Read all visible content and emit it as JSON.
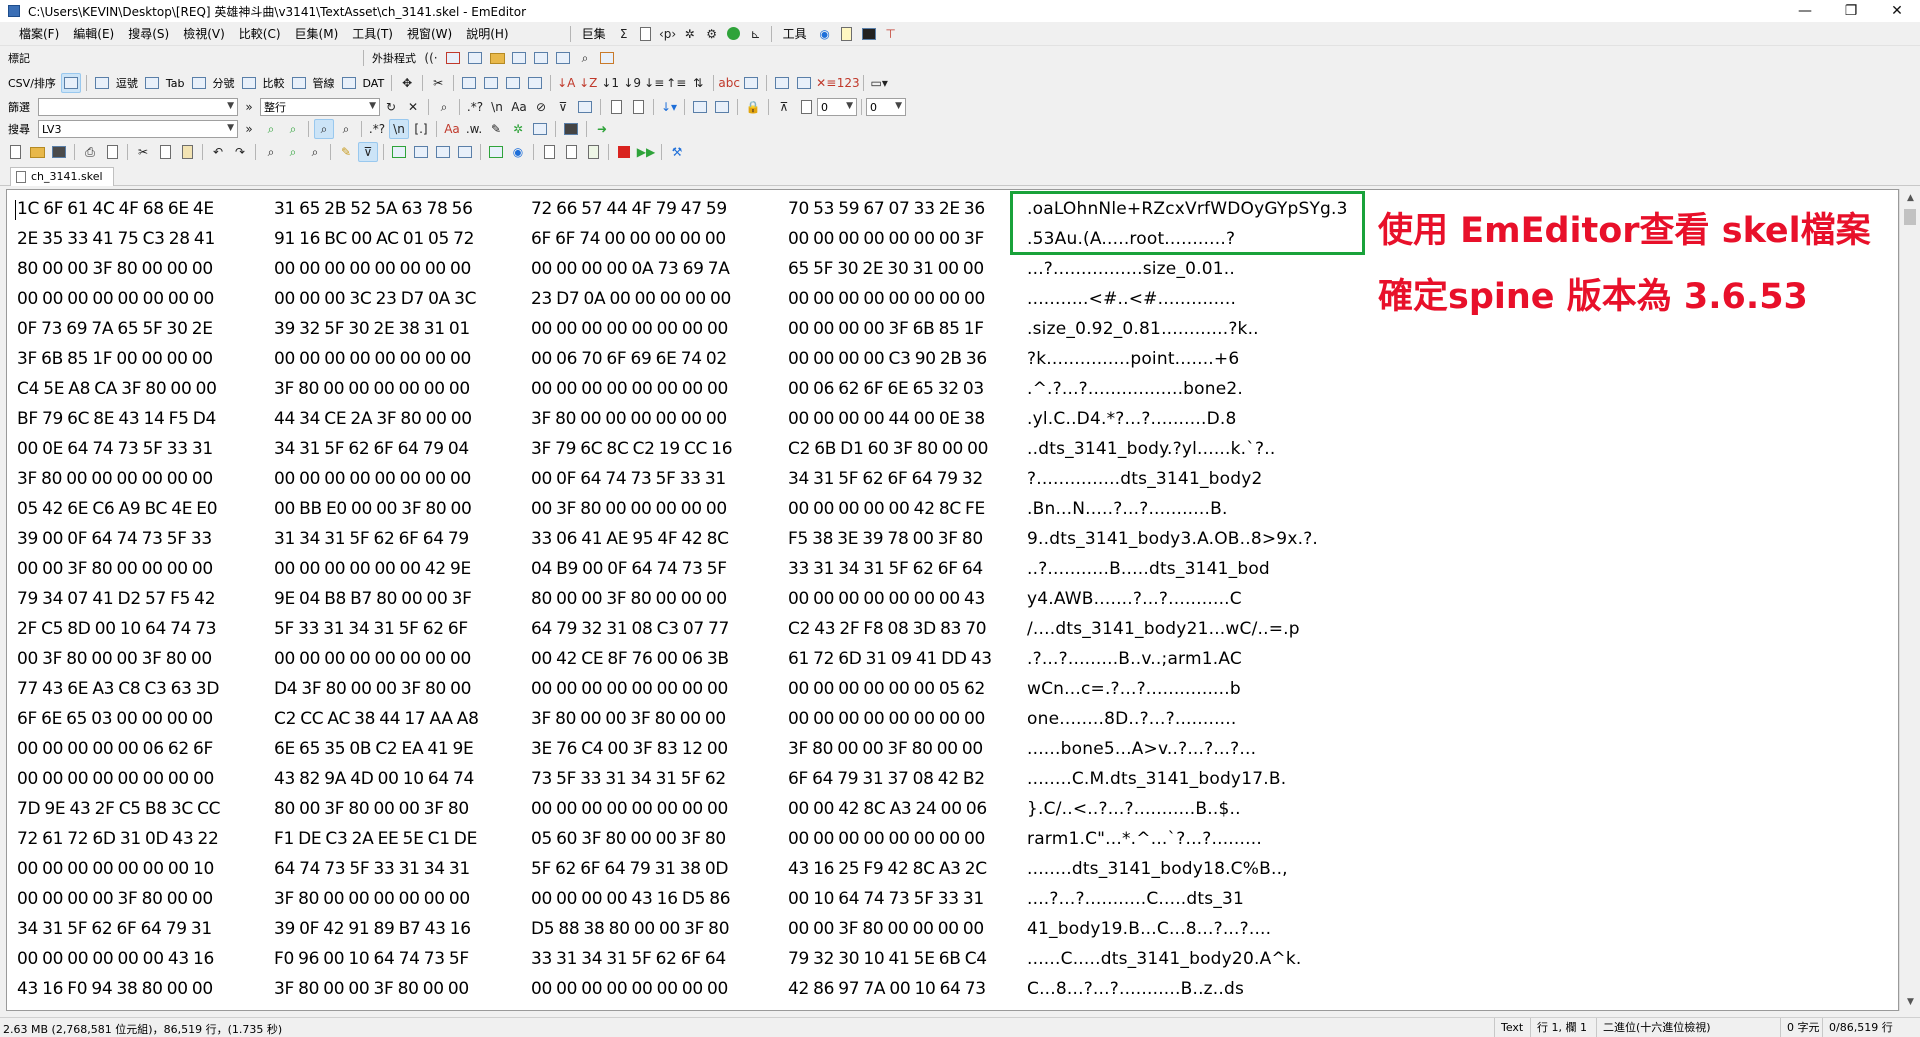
{
  "window": {
    "title": "C:\\Users\\KEVIN\\Desktop\\[REQ] 英雄神斗曲\\v3141\\TextAsset\\ch_3141.skel - EmEditor",
    "minimize": "—",
    "maximize": "❐",
    "close": "✕"
  },
  "menu": {
    "items": [
      "檔案(F)",
      "編輯(E)",
      "搜尋(S)",
      "檢視(V)",
      "比較(C)",
      "巨集(M)",
      "工具(T)",
      "視窗(W)",
      "說明(H)"
    ],
    "macro_label": "巨集",
    "tools_label": "工具"
  },
  "toolbars": {
    "bookmark_label": "標記",
    "external_label": "外掛程式",
    "csv_label": "CSV/排序",
    "csv_modes": [
      "逗號",
      "Tab",
      "分號",
      "比較",
      "管線",
      "DAT"
    ],
    "filter_label": "篩選",
    "filter_value": "",
    "filter_mode": "整行",
    "search_label": "搜尋",
    "search_value": "LV3",
    "dropdown_value_a": "0",
    "dropdown_value_b": "0"
  },
  "tab": {
    "filename": "ch_3141.skel"
  },
  "hex": {
    "rows": [
      [
        "1C 6F 61 4C 4F 68 6E 4E",
        "31 65 2B 52 5A 63 78 56",
        "72 66 57 44 4F 79 47 59",
        "70 53 59 67 07 33 2E 36"
      ],
      [
        "2E 35 33 41 75 C3 28 41",
        "91 16 BC 00 AC 01 05 72",
        "6F 6F 74 00 00 00 00 00",
        "00 00 00 00 00 00 00 3F"
      ],
      [
        "80 00 00 3F 80 00 00 00",
        "00 00 00 00 00 00 00 00",
        "00 00 00 00 0A 73 69 7A",
        "65 5F 30 2E 30 31 00 00"
      ],
      [
        "00 00 00 00 00 00 00 00",
        "00 00 00 3C 23 D7 0A 3C",
        "23 D7 0A 00 00 00 00 00",
        "00 00 00 00 00 00 00 00"
      ],
      [
        "0F 73 69 7A 65 5F 30 2E",
        "39 32 5F 30 2E 38 31 01",
        "00 00 00 00 00 00 00 00",
        "00 00 00 00 3F 6B 85 1F"
      ],
      [
        "3F 6B 85 1F 00 00 00 00",
        "00 00 00 00 00 00 00 00",
        "00 06 70 6F 69 6E 74 02",
        "00 00 00 00 C3 90 2B 36"
      ],
      [
        "C4 5E A8 CA 3F 80 00 00",
        "3F 80 00 00 00 00 00 00",
        "00 00 00 00 00 00 00 00",
        "00 06 62 6F 6E 65 32 03"
      ],
      [
        "BF 79 6C 8E 43 14 F5 D4",
        "44 34 CE 2A 3F 80 00 00",
        "3F 80 00 00 00 00 00 00",
        "00 00 00 00 44 00 0E 38"
      ],
      [
        "00 0E 64 74 73 5F 33 31",
        "34 31 5F 62 6F 64 79 04",
        "3F 79 6C 8C C2 19 CC 16",
        "C2 6B D1 60 3F 80 00 00"
      ],
      [
        "3F 80 00 00 00 00 00 00",
        "00 00 00 00 00 00 00 00",
        "00 0F 64 74 73 5F 33 31",
        "34 31 5F 62 6F 64 79 32"
      ],
      [
        "05 42 6E C6 A9 BC 4E E0",
        "00 BB E0 00 00 3F 80 00",
        "00 3F 80 00 00 00 00 00",
        "00 00 00 00 00 42 8C FE"
      ],
      [
        "39 00 0F 64 74 73 5F 33",
        "31 34 31 5F 62 6F 64 79",
        "33 06 41 AE 95 4F 42 8C",
        "F5 38 3E 39 78 00 3F 80"
      ],
      [
        "00 00 3F 80 00 00 00 00",
        "00 00 00 00 00 00 42 9E",
        "04 B9 00 0F 64 74 73 5F",
        "33 31 34 31 5F 62 6F 64"
      ],
      [
        "79 34 07 41 D2 57 F5 42",
        "9E 04 B8 B7 80 00 00 3F",
        "80 00 00 3F 80 00 00 00",
        "00 00 00 00 00 00 00 43"
      ],
      [
        "2F C5 8D 00 10 64 74 73",
        "5F 33 31 34 31 5F 62 6F",
        "64 79 32 31 08 C3 07 77",
        "C2 43 2F F8 08 3D 83 70"
      ],
      [
        "00 3F 80 00 00 3F 80 00",
        "00 00 00 00 00 00 00 00",
        "00 42 CE 8F 76 00 06 3B",
        "61 72 6D 31 09 41 DD 43"
      ],
      [
        "77 43 6E A3 C8 C3 63 3D",
        "D4 3F 80 00 00 3F 80 00",
        "00 00 00 00 00 00 00 00",
        "00 00 00 00 00 00 05 62"
      ],
      [
        "6F 6E 65 03 00 00 00 00",
        "C2 CC AC 38 44 17 AA A8",
        "3F 80 00 00 3F 80 00 00",
        "00 00 00 00 00 00 00 00"
      ],
      [
        "00 00 00 00 00 06 62 6F",
        "6E 65 35 0B C2 EA 41 9E",
        "3E 76 C4 00 3F 83 12 00",
        "3F 80 00 00 3F 80 00 00"
      ],
      [
        "00 00 00 00 00 00 00 00",
        "43 82 9A 4D 00 10 64 74",
        "73 5F 33 31 34 31 5F 62",
        "6F 64 79 31 37 08 42 B2"
      ],
      [
        "7D 9E 43 2F C5 B8 3C CC",
        "80 00 3F 80 00 00 3F 80",
        "00 00 00 00 00 00 00 00",
        "00 00 42 8C A3 24 00 06"
      ],
      [
        "72 61 72 6D 31 0D 43 22",
        "F1 DE C3 2A EE 5E C1 DE",
        "05 60 3F 80 00 00 3F 80",
        "00 00 00 00 00 00 00 00"
      ],
      [
        "00 00 00 00 00 00 00 10",
        "64 74 73 5F 33 31 34 31",
        "5F 62 6F 64 79 31 38 0D",
        "43 16 25 F9 42 8C A3 2C"
      ],
      [
        "00 00 00 00 3F 80 00 00",
        "3F 80 00 00 00 00 00 00",
        "00 00 00 00 43 16 D5 86",
        "00 10 64 74 73 5F 33 31"
      ],
      [
        "34 31 5F 62 6F 64 79 31",
        "39 0F 42 91 89 B7 43 16",
        "D5 88 38 80 00 00 3F 80",
        "00 00 3F 80 00 00 00 00"
      ],
      [
        "00 00 00 00 00 00 43 16",
        "F0 96 00 10 64 74 73 5F",
        "33 31 34 31 5F 62 6F 64",
        "79 32 30 10 41 5E 6B C4"
      ],
      [
        "43 16 F0 94 38 80 00 00",
        "3F 80 00 00 3F 80 00 00",
        "00 00 00 00 00 00 00 00",
        "42 86 97 7A 00 10 64 73"
      ]
    ],
    "ascii": [
      ".oaLOhnNle+RZcxVrfWDOyGYpSYg.3.6",
      ".53Au.(A.....root...........?",
      "...?................size_0.01..",
      "...........<#..<#..............",
      ".size_0.92_0.81............?k..",
      "?k...............point.......+6",
      ".^.?...?.................bone2.",
      ".yl.C..D4.*?...?..........D.8",
      "..dts_3141_body.?yl......k.`?..",
      "?...............dts_3141_body2",
      ".Bn...N.....?...?...........B.",
      "9..dts_3141_body3.A.OB..8>9x.?.",
      "..?...........B.....dts_3141_bod",
      "y4.AWB.......?...?...........C",
      "/....dts_3141_body21...wC/..=.p",
      ".?...?.........B..v..;arm1.AC",
      "wCn...c=.?...?...............b",
      "one........8D..?...?...........",
      "......bone5...A>v..?...?...?...",
      "........C.M.dts_3141_body17.B.",
      "}.C/..<..?...?...........B..$..",
      "rarm1.C\"...*.^...`?...?.........",
      "........dts_3141_body18.C%B..,",
      "....?...?...........C.....dts_31",
      "41_body19.B...C...8...?...?....",
      "......C.....dts_3141_body20.A^k.",
      "C...8...?...?...........B..z..ds"
    ]
  },
  "annotation": {
    "line1": "使用 EmEditor查看 skel檔案",
    "line2": "確定spine 版本為 3.6.53"
  },
  "status": {
    "size": "2.63 MB (2,768,581 位元組)，86,519 行，(1.735 秒)",
    "mode": "Text",
    "position": "行 1, 欄 1",
    "view": "二進位(十六進位檢視)",
    "chars": "0 字元",
    "offset": "0/86,519 行"
  },
  "colors": {
    "highlight_box": "#19a23a",
    "annotation_text": "#e8102a"
  }
}
